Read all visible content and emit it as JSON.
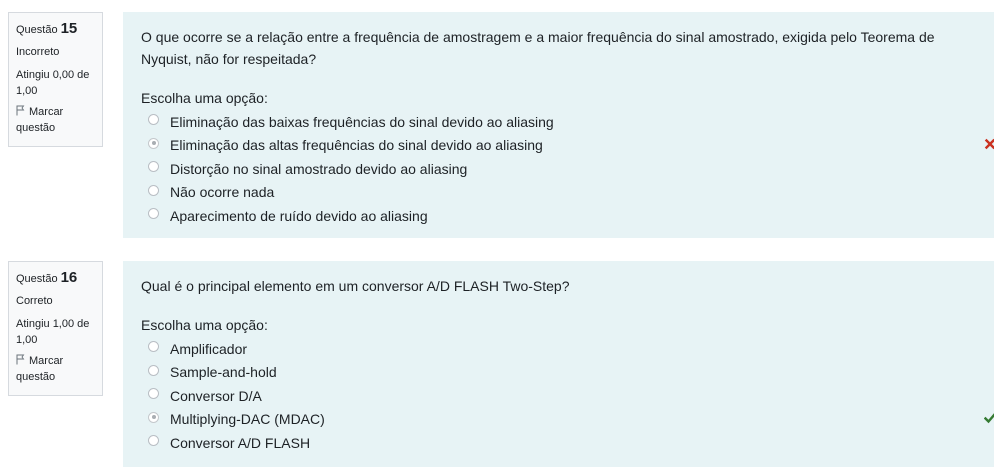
{
  "questions": [
    {
      "number_label": "Questão",
      "number": "15",
      "state": "Incorreto",
      "grade": "Atingiu 0,00 de 1,00",
      "flag_label": "Marcar questão",
      "text": "O que ocorre se a relação entre a frequência de amostragem e a maior frequência do sinal amostrado, exigida pelo Teorema de Nyquist, não for respeitada?",
      "prompt": "Escolha uma opção:",
      "options": [
        "Eliminação das baixas frequências do sinal devido ao aliasing",
        "Eliminação das altas frequências do sinal devido ao aliasing",
        "Distorção no sinal amostrado devido ao aliasing",
        "Não ocorre nada",
        "Aparecimento de ruído devido ao aliasing"
      ],
      "selected_option": "Eliminação das altas frequências do sinal devido ao aliasing",
      "result_icon": "incorrect-x-icon",
      "result_color": "#ca3120"
    },
    {
      "number_label": "Questão",
      "number": "16",
      "state": "Correto",
      "grade": "Atingiu 1,00 de 1,00",
      "flag_label": "Marcar questão",
      "text": "Qual é o principal elemento em um conversor A/D FLASH Two-Step?",
      "prompt": "Escolha uma opção:",
      "options": [
        "Amplificador",
        "Sample-and-hold",
        "Conversor D/A",
        "Multiplying-DAC (MDAC)",
        "Conversor A/D FLASH"
      ],
      "selected_option": "Multiplying-DAC (MDAC)",
      "result_icon": "correct-check-icon",
      "result_color": "#357a32"
    }
  ]
}
